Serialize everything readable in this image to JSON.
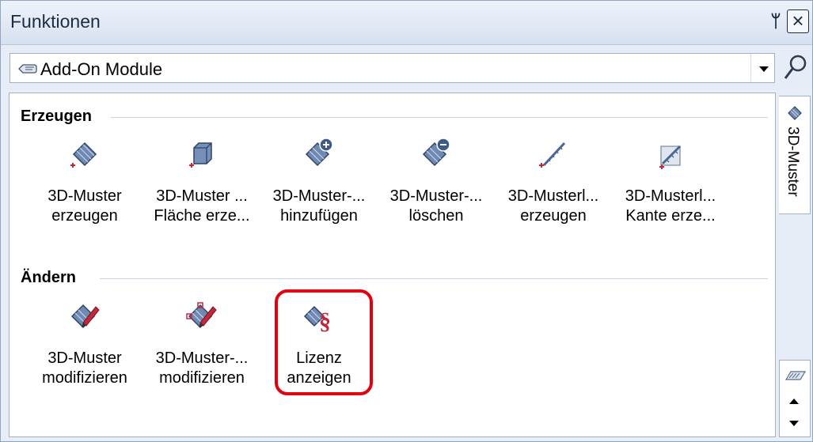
{
  "window": {
    "title": "Funktionen",
    "pin_glyph": "ᛘ",
    "close_glyph": "×"
  },
  "combo": {
    "value": "Add-On Module",
    "icon": "hand-pointer-icon"
  },
  "groups": [
    {
      "title": "Erzeugen",
      "tools": [
        {
          "line1": "3D-Muster",
          "line2": "erzeugen",
          "icon": "pattern-create-icon"
        },
        {
          "line1": "3D-Muster ...",
          "line2": "Fläche erze...",
          "icon": "pattern-surface-icon"
        },
        {
          "line1": "3D-Muster-...",
          "line2": "hinzufügen",
          "icon": "pattern-add-icon"
        },
        {
          "line1": "3D-Muster-...",
          "line2": "löschen",
          "icon": "pattern-delete-icon"
        },
        {
          "line1": "3D-Musterl...",
          "line2": "erzeugen",
          "icon": "pattern-line-create-icon"
        },
        {
          "line1": "3D-Musterl...",
          "line2": "Kante erze...",
          "icon": "pattern-line-edge-icon"
        }
      ]
    },
    {
      "title": "Ändern",
      "tools": [
        {
          "line1": "3D-Muster",
          "line2": "modifizieren",
          "icon": "pattern-modify-icon"
        },
        {
          "line1": "3D-Muster-...",
          "line2": "modifizieren",
          "icon": "pattern-point-modify-icon"
        },
        {
          "line1": "Lizenz",
          "line2": "anzeigen",
          "icon": "license-icon"
        }
      ]
    }
  ],
  "sidebar": {
    "tab_label": "3D-Muster"
  },
  "colors": {
    "highlight": "#e3000f",
    "accent": "#8ea4c1"
  }
}
